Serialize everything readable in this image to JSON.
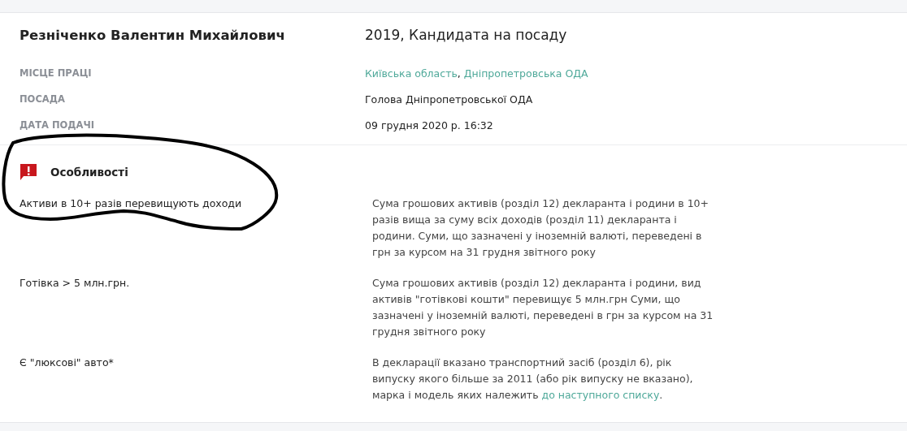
{
  "person": {
    "name": "Резніченко Валентин Михайлович",
    "declaration": "2019, Кандидата на посаду"
  },
  "fields": [
    {
      "label": "МІСЦЕ ПРАЦІ",
      "kind": "links",
      "links": [
        "Київська область",
        "Дніпропетровська ОДА"
      ],
      "separator": ", "
    },
    {
      "label": "ПОСАДА",
      "kind": "text",
      "value": "Голова Дніпропетровської ОДА"
    },
    {
      "label": "ДАТА ПОДАЧІ",
      "kind": "text",
      "value": "09 грудня 2020 р. 16:32"
    }
  ],
  "features": {
    "title": "Особливості",
    "items": [
      {
        "name": "Активи в 10+ разів перевищують доходи",
        "description": "Сума грошових активів (розділ 12) декларанта і родини в 10+ разів вища за суму всіх доходів (розділ 11) декларанта і родини. Суми, що зазначені у іноземній валюті, переведені в грн за курсом на 31 грудня звітного року"
      },
      {
        "name": "Готівка > 5 млн.грн.",
        "description": "Сума грошових активів (розділ 12) декларанта і родини, вид активів \"готівкові кошти\" перевищує 5 млн.грн Суми, що зазначені у іноземній валюті, переведені в грн за курсом на 31 грудня звітного року"
      },
      {
        "name": "Є \"люксові\" авто*",
        "description": "В декларації вказано транспортний засіб (розділ 6), рік випуску якого більше за 2011 (або рік випуску не вказано), марка і модель яких належить ",
        "link": "до наступного списку",
        "after": "."
      }
    ]
  },
  "annotation": {
    "kind": "freehand-loop"
  }
}
